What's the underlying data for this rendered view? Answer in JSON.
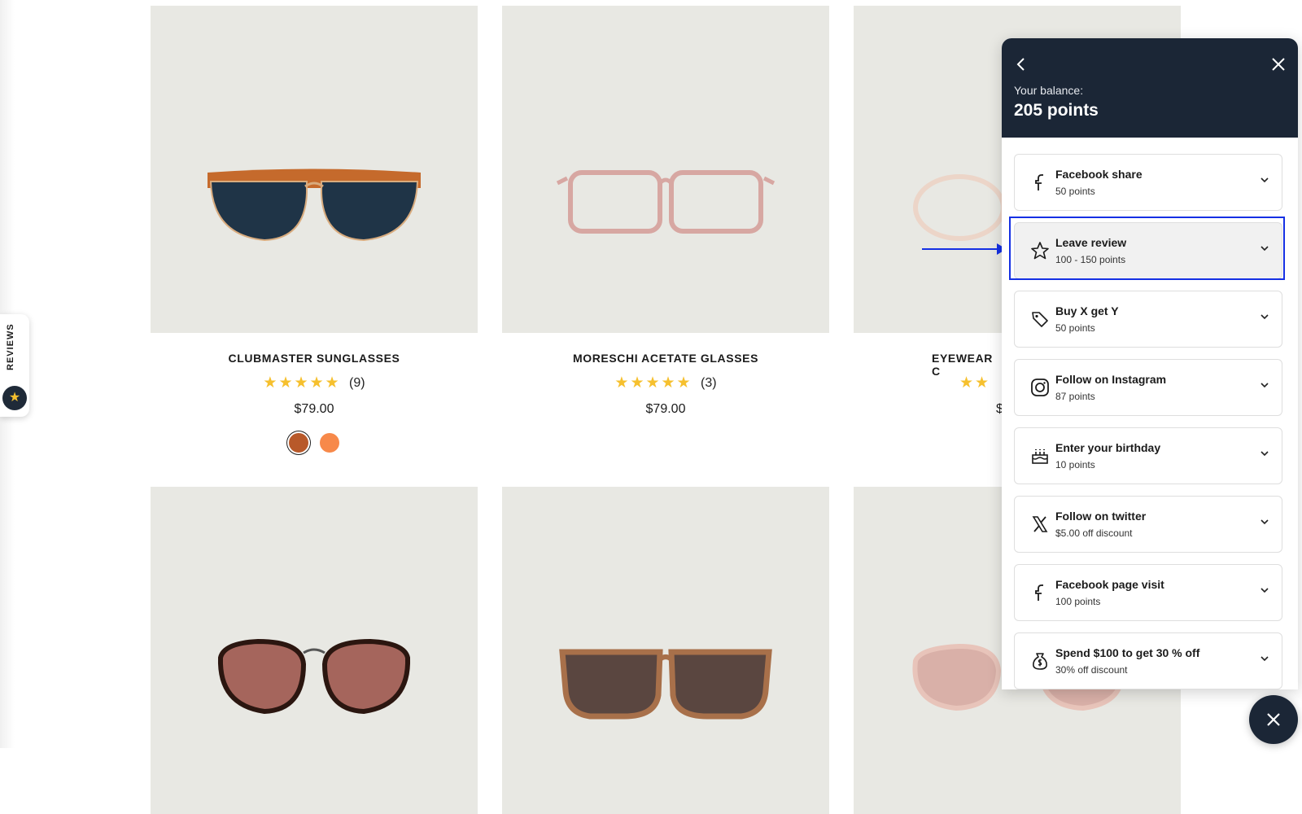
{
  "products": [
    {
      "name": "CLUBMASTER SUNGLASSES",
      "stars": "★★★★★",
      "count": "(9)",
      "price": "$79.00",
      "swatches": [
        "#b8592a",
        "#f7894a"
      ]
    },
    {
      "name": "MORESCHI ACETATE GLASSES",
      "stars": "★★★★★",
      "count": "(3)",
      "price": "$79.00"
    },
    {
      "name": "EYEWEAR C",
      "stars": "★★",
      "price": "$"
    }
  ],
  "reviews_tab": {
    "label": "REVIEWS",
    "icon": "★"
  },
  "rewards": {
    "balance_label": "Your balance:",
    "balance_value": "205 points",
    "items": [
      {
        "name": "Facebook share",
        "points": "50 points",
        "icon": "facebook-icon"
      },
      {
        "name": "Leave review",
        "points": "100 - 150 points",
        "icon": "star-icon"
      },
      {
        "name": "Buy X get Y",
        "points": "50 points",
        "icon": "tag-icon"
      },
      {
        "name": "Follow on Instagram",
        "points": "87 points",
        "icon": "instagram-icon"
      },
      {
        "name": "Enter your birthday",
        "points": "10 points",
        "icon": "cake-icon"
      },
      {
        "name": "Follow on twitter",
        "points": "$5.00 off discount",
        "icon": "x-twitter-icon"
      },
      {
        "name": "Facebook page visit",
        "points": "100 points",
        "icon": "facebook-icon"
      },
      {
        "name": "Spend $100 to get 30 % off",
        "points": "30% off discount",
        "icon": "money-bag-icon"
      }
    ]
  },
  "colors": {
    "panel_header": "#1b2636",
    "star": "#f6c02e",
    "highlight": "#1530e4",
    "image_bg": "#e8e8e3"
  }
}
